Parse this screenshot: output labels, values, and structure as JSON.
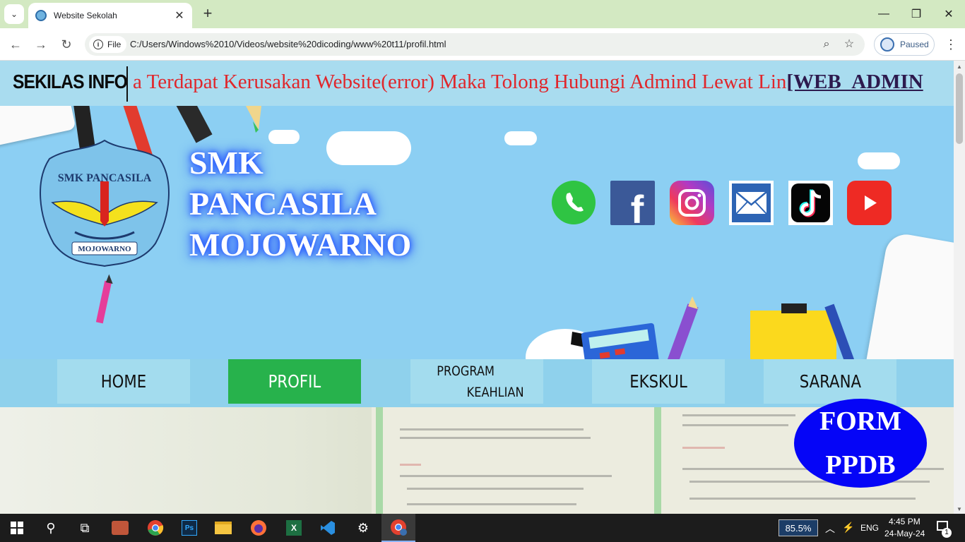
{
  "browser": {
    "tab_title": "Website Sekolah",
    "site_chip": "File",
    "url": "C:/Users/Windows%2010/Videos/website%20dicoding/www%20t11/profil.html",
    "profile_status": "Paused"
  },
  "page": {
    "info_label": "SEKILAS INFO",
    "marquee_text": "a Terdapat Kerusakan Website(error) Maka Tolong Hubungi Admind Lewat Lin",
    "marquee_link": "[WEB_ADMIN",
    "school_name": {
      "line1": "SMK",
      "line2": "PANCASILA",
      "line3": "MOJOWARNO"
    },
    "logo": {
      "top_text": "SMK PANCASILA",
      "bottom_text": "MOJOWARNO"
    },
    "social_icons": [
      "whatsapp-icon",
      "facebook-icon",
      "instagram-icon",
      "email-icon",
      "tiktok-icon",
      "youtube-icon"
    ],
    "nav": {
      "home": "HOME",
      "profil": "PROFIL",
      "program_line1": "PROGRAM",
      "program_line2": "KEAHLIAN",
      "ekskul": "EKSKUL",
      "sarana": "SARANA"
    },
    "ppdb": {
      "line1": "FORM",
      "line2": "PPDB"
    },
    "colors": {
      "active_nav": "#27b24c",
      "ppdb": "#0505f7",
      "marquee": "#e0262b",
      "banner": "#8ccff3"
    }
  },
  "taskbar": {
    "zoom": "85.5%",
    "language": "ENG",
    "time": "4:45 PM",
    "date": "24-May-24",
    "notification_count": "1"
  }
}
